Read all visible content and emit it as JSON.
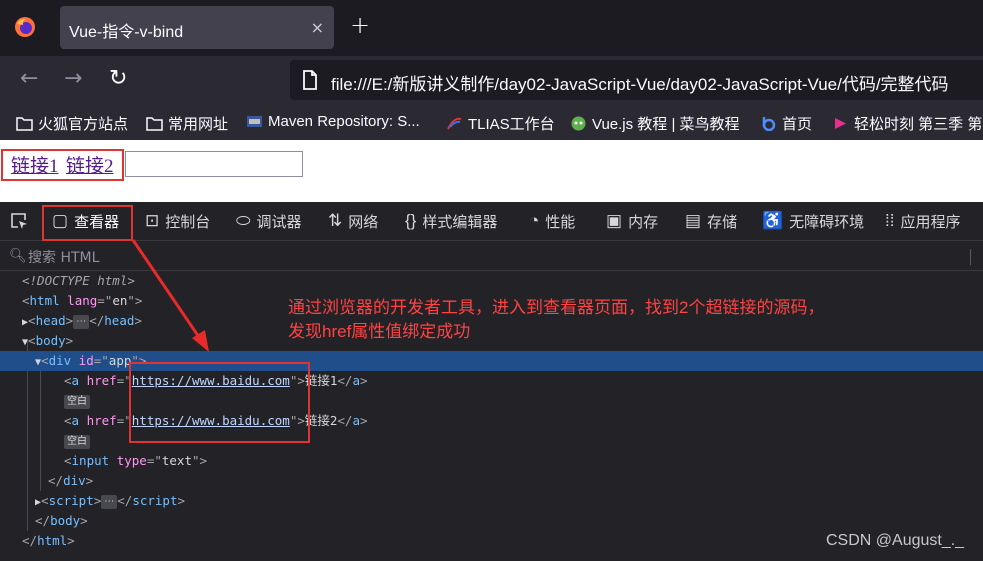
{
  "browser": {
    "tab_title": "Vue-指令-v-bind",
    "tab_close": "×",
    "new_tab": "+",
    "url": "file:///E:/新版讲义制作/day02-JavaScript-Vue/day02-JavaScript-Vue/代码/完整代码"
  },
  "bookmarks": [
    {
      "label": "火狐官方站点"
    },
    {
      "label": "常用网址"
    },
    {
      "label": "Maven Repository: S..."
    },
    {
      "label": "TLIAS工作台"
    },
    {
      "label": "Vue.js 教程 | 菜鸟教程"
    },
    {
      "label": "首页"
    },
    {
      "label": "轻松时刻 第三季 第"
    }
  ],
  "page": {
    "link1": "链接1",
    "link2": "链接2",
    "input_value": ""
  },
  "devtools": {
    "tabs": [
      {
        "label": "查看器",
        "icon": "inspector-icon"
      },
      {
        "label": "控制台",
        "icon": "console-icon"
      },
      {
        "label": "调试器",
        "icon": "debugger-icon"
      },
      {
        "label": "网络",
        "icon": "network-icon"
      },
      {
        "label": "样式编辑器",
        "icon": "style-editor-icon"
      },
      {
        "label": "性能",
        "icon": "performance-icon"
      },
      {
        "label": "内存",
        "icon": "memory-icon"
      },
      {
        "label": "存储",
        "icon": "storage-icon"
      },
      {
        "label": "无障碍环境",
        "icon": "accessibility-icon"
      },
      {
        "label": "应用程序",
        "icon": "application-icon"
      }
    ],
    "search_placeholder": "搜索 HTML",
    "tree": {
      "doctype": "<!DOCTYPE html>",
      "html_tag": "html",
      "lang_attr": "lang",
      "lang_val": "en",
      "head_tag": "head",
      "body_tag": "body",
      "div_tag": "div",
      "id_attr": "id",
      "id_val": "app",
      "a_tag": "a",
      "href_attr": "href",
      "href_val": "https://www.baidu.com",
      "a1_text": "链接1",
      "a2_text": "链接2",
      "whitespace_badge": "空白",
      "ellipsis_badge": "⋯",
      "input_tag": "input",
      "type_attr": "type",
      "type_val": "text",
      "script_tag": "script"
    }
  },
  "annotation": {
    "line1": "通过浏览器的开发者工具，进入到查看器页面，找到2个超链接的源码，",
    "line2": "发现href属性值绑定成功"
  },
  "watermark": "CSDN @August_._"
}
